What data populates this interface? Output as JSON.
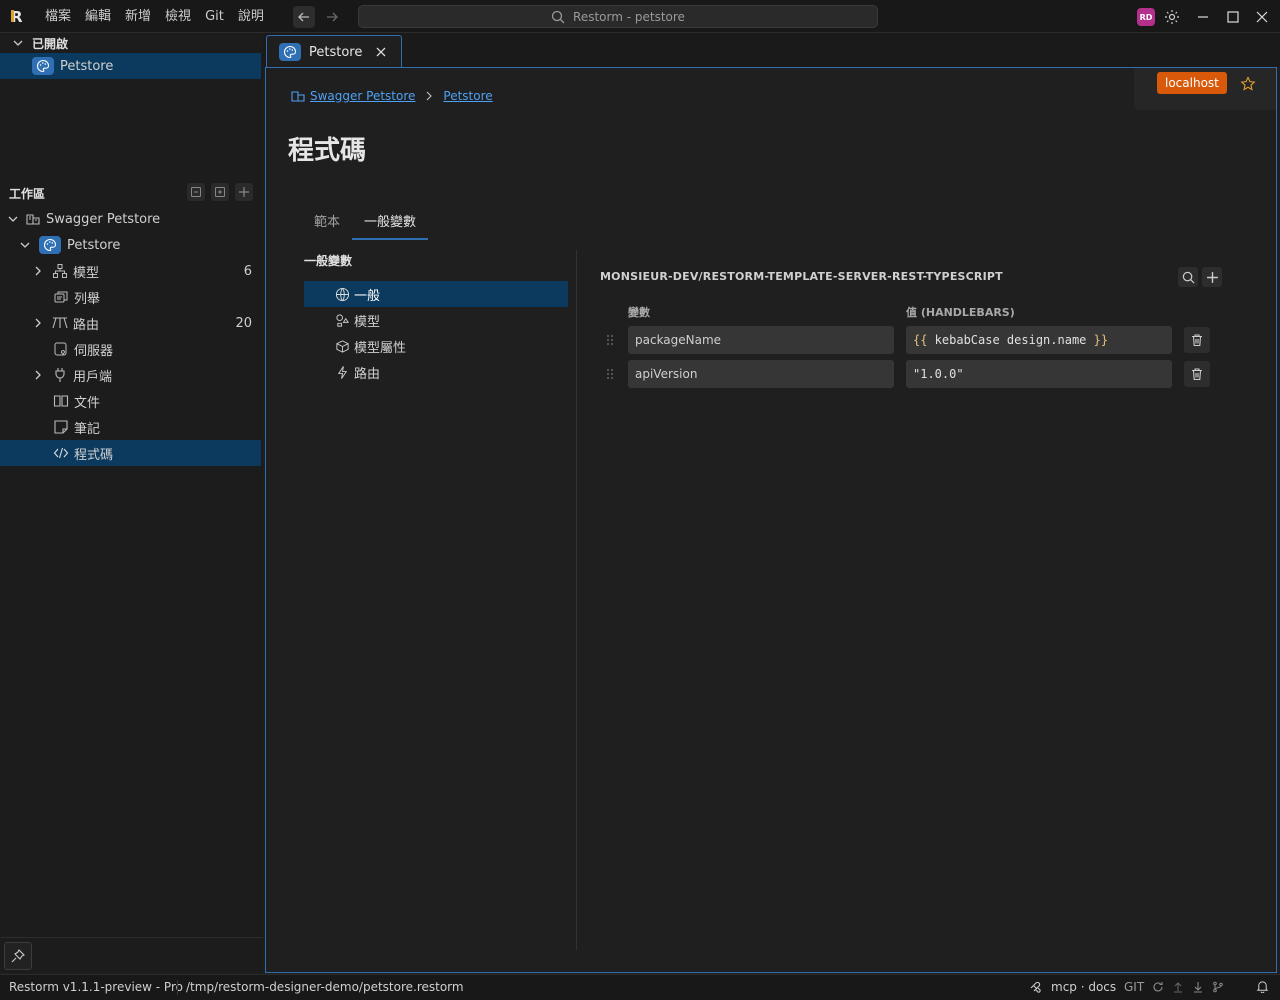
{
  "app": {
    "logo_letter": "R",
    "search_text": "Restorm - petstore",
    "avatar_initials": "RD"
  },
  "menu": [
    "檔案",
    "編輯",
    "新增",
    "檢視",
    "Git",
    "說明"
  ],
  "sidebar": {
    "opened_header": "已開啟",
    "opened_items": [
      {
        "label": "Petstore"
      }
    ],
    "workspace_header": "工作區",
    "tree": {
      "root": "Swagger Petstore",
      "project": "Petstore",
      "items": [
        {
          "label": "模型",
          "count": "6"
        },
        {
          "label": "列舉",
          "count": ""
        },
        {
          "label": "路由",
          "count": "20"
        },
        {
          "label": "伺服器",
          "count": ""
        },
        {
          "label": "用戶端",
          "count": ""
        },
        {
          "label": "文件",
          "count": ""
        },
        {
          "label": "筆記",
          "count": ""
        },
        {
          "label": "程式碼",
          "count": ""
        }
      ]
    }
  },
  "tab": {
    "label": "Petstore"
  },
  "environment": {
    "label": "localhost",
    "color": "#d9590b"
  },
  "breadcrumb": {
    "root": "Swagger Petstore",
    "current": "Petstore"
  },
  "page": {
    "title": "程式碼"
  },
  "subtabs": [
    "範本",
    "一般變數"
  ],
  "variables_section": {
    "label": "一般變數",
    "categories": [
      "一般",
      "模型",
      "模型屬性",
      "路由"
    ]
  },
  "package": {
    "title": "MONSIEUR-DEV/RESTORM-TEMPLATE-SERVER-REST-TYPESCRIPT",
    "col_variable": "變數",
    "col_value": "值 (HANDLEBARS)",
    "rows": [
      {
        "name": "packageName",
        "value_open": "{{",
        "value_body": " kebabCase design.name ",
        "value_close": "}}"
      },
      {
        "name": "apiVersion",
        "value": "\"1.0.0\""
      }
    ]
  },
  "status": {
    "version": "Restorm v1.1.1-preview - Pro",
    "path": "/tmp/restorm-designer-demo/petstore.restorm",
    "mcp": "mcp · docs",
    "git": "GIT"
  },
  "colors": {
    "accent": "#2d6fb0",
    "selection": "#0b3a5e",
    "link": "#4ea1f3"
  }
}
